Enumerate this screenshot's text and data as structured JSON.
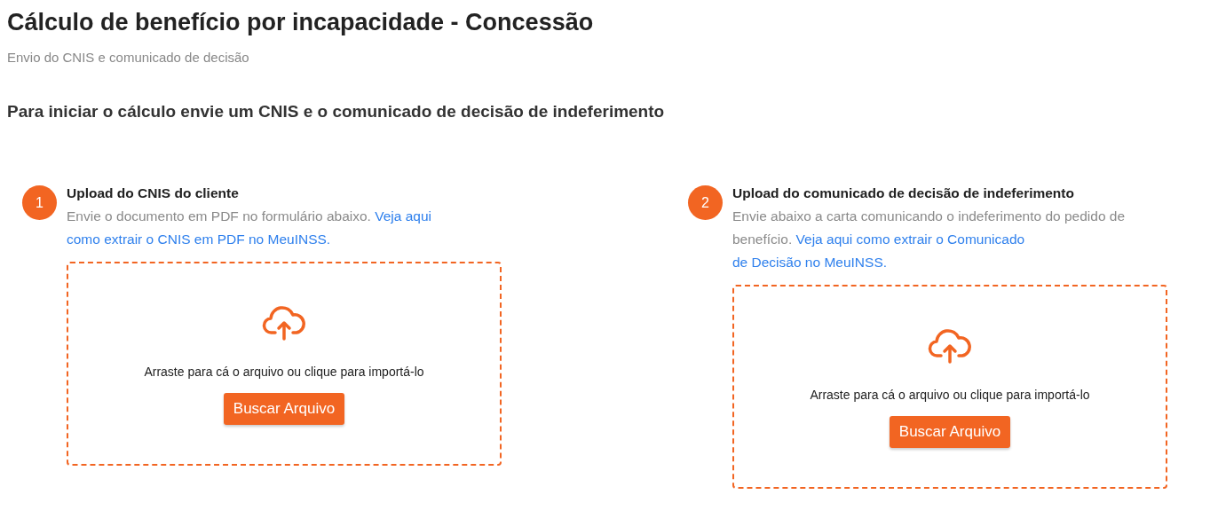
{
  "page": {
    "title": "Cálculo de benefício por incapacidade - Concessão",
    "subtitle": "Envio do CNIS e comunicado de decisão"
  },
  "heading": "Para iniciar o cálculo envie um CNIS e o comunicado de decisão de indeferimento",
  "steps": [
    {
      "number": "1",
      "title": "Upload do CNIS do cliente",
      "description": "Envie o documento em PDF no formulário abaixo.",
      "link_lines": [
        "Veja aqui",
        "como extrair o CNIS em PDF no MeuINSS."
      ],
      "dropzone": {
        "hint": "Arraste para cá o arquivo ou clique para importá-lo",
        "button": "Buscar Arquivo"
      }
    },
    {
      "number": "2",
      "title": "Upload do comunicado de decisão de indeferimento",
      "description": "Envie abaixo a carta comunicando o indeferimento do pedido de benefício.",
      "link_lines": [
        "Veja aqui como extrair o Comunicado",
        "de Decisão no MeuINSS."
      ],
      "dropzone": {
        "hint": "Arraste para cá o arquivo ou clique para importá-lo",
        "button": "Buscar Arquivo"
      }
    }
  ]
}
